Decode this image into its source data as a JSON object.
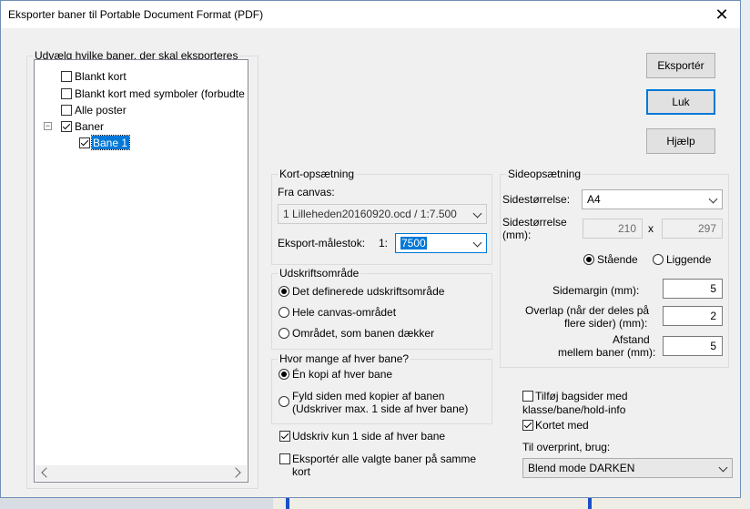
{
  "dialog": {
    "title": "Eksporter baner til Portable Document Format (PDF)",
    "close_glyph": "✕"
  },
  "courses_group": {
    "legend": "Udvælg hvilke baner, der skal eksporteres",
    "items": [
      {
        "label": "Blankt kort",
        "checked": false
      },
      {
        "label": "Blankt kort med symboler (forbudte",
        "checked": false
      },
      {
        "label": "Alle poster",
        "checked": false
      },
      {
        "label": "Baner",
        "checked": true,
        "expander": "−"
      },
      {
        "label": "Bane 1",
        "checked": true,
        "selected": true
      }
    ]
  },
  "buttons": {
    "export": "Eksportér",
    "close": "Luk",
    "help": "Hjælp"
  },
  "map_setup": {
    "legend": "Kort-opsætning",
    "from_canvas_label": "Fra canvas:",
    "canvas_value": "1 Lilleheden20160920.ocd  / 1:7.500",
    "export_scale_label": "Eksport-målestok:",
    "scale_prefix": "1:",
    "scale_value": "7500"
  },
  "print_area": {
    "legend": "Udskriftsområde",
    "options": [
      "Det definerede udskriftsområde",
      "Hele canvas-området",
      "Området, som banen dækker"
    ],
    "selected": 0
  },
  "copies": {
    "legend": "Hvor mange af hver bane?",
    "option1": "Én kopi af hver bane",
    "option2_line1": "Fyld siden med kopier af banen",
    "option2_line2": "(Udskriver max. 1 side af hver bane)",
    "selected": 0
  },
  "page_setup": {
    "legend": "Sideopsætning",
    "page_size_label": "Sidestørrelse:",
    "page_size_value": "A4",
    "page_size_mm_label_line1": "Sidestørrelse",
    "page_size_mm_label_line2": "(mm):",
    "width_mm": "210",
    "x_symbol": "x",
    "height_mm": "297",
    "portrait": "Stående",
    "landscape": "Liggende",
    "orientation_selected": "portrait",
    "margin_label": "Sidemargin (mm):",
    "margin_value": "5",
    "overlap_label_line1": "Overlap (når der deles på",
    "overlap_label_line2": "flere sider) (mm):",
    "overlap_value": "2",
    "distance_label_line1": "Afstand",
    "distance_label_line2": "mellem baner (mm):",
    "distance_value": "5"
  },
  "options": {
    "single_page": {
      "label": "Udskriv kun 1 side af hver bane",
      "checked": true
    },
    "same_map_line1": "Eksportér alle valgte baner på samme",
    "same_map_line2": "kort",
    "same_map_checked": false,
    "back_pages_line1": "Tilføj bagsider med",
    "back_pages_line2": "klasse/bane/hold-info",
    "back_pages_checked": false,
    "map_too": {
      "label": "Kortet med",
      "checked": true
    },
    "overprint_label": "Til overprint, brug:",
    "overprint_value": "Blend mode DARKEN"
  },
  "colors": {
    "accent": "#0078d7",
    "dialog_bg": "#f0f0f0",
    "border": "#6f8fb4"
  }
}
